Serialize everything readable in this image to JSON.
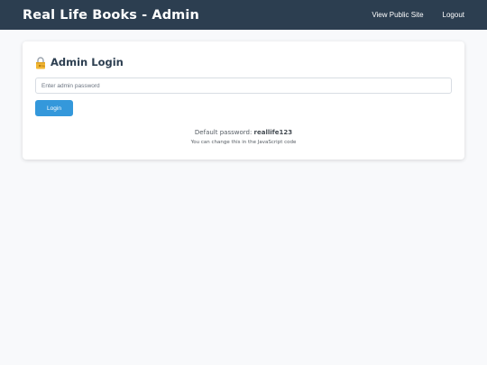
{
  "header": {
    "title": "Real Life Books - Admin",
    "nav": {
      "public_site": "View Public Site",
      "logout": "Logout"
    },
    "background_color": "#2c3e50"
  },
  "login": {
    "title": "Admin Login",
    "title_icon": "lock-with-key-icon",
    "password_placeholder": "Enter admin password",
    "password_value": "",
    "button_label": "Login",
    "button_color": "#3498db",
    "hint_prefix": "Default password:",
    "hint_password": "reallife123",
    "hint_sub": "You can change this in the JavaScript code"
  }
}
